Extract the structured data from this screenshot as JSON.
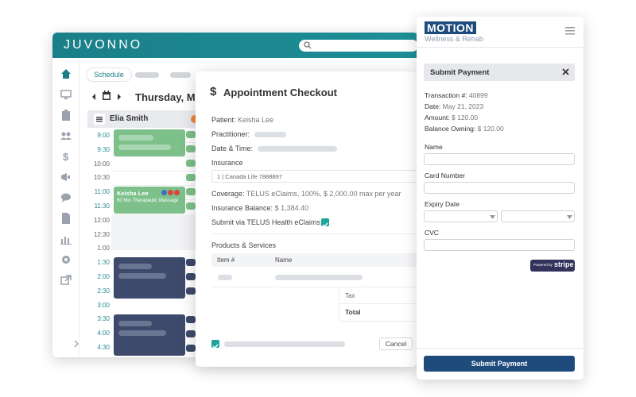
{
  "juvonno": {
    "logo": "JUVONNO",
    "tab_schedule": "Schedule",
    "date": "Thursday, May",
    "provider": "Elia Smith",
    "times": [
      "9:00",
      "9:30",
      "10:00",
      "10:30",
      "11:00",
      "11:30",
      "12:00",
      "12:30",
      "1:00",
      "1:30",
      "2:00",
      "2:30",
      "3:00",
      "3:30",
      "4:00",
      "4:30"
    ],
    "appointment": {
      "patient": "Keisha Lee",
      "service": "60 Min Therapeutic Massage"
    },
    "colors": {
      "teal": "#1a7f88",
      "green": "#7dc08a",
      "navy": "#3d4a6b"
    }
  },
  "checkout": {
    "title": "Appointment Checkout",
    "title_icon": "dollar-icon",
    "patient_label": "Patient:",
    "patient_value": "Keisha Lee",
    "practitioner_label": "Practitioner:",
    "datetime_label": "Date & Time:",
    "insurance_label": "Insurance",
    "insurance_value": "1 | Canada Life 7888897",
    "coverage_label": "Coverage:",
    "coverage_value": "TELUS eClaims, 100%, $ 2,000.00 max per year",
    "balance_label": "Insurance Balance:",
    "balance_value": "$ 1,384.40",
    "submit_label": "Submit via TELUS Health eClaims:",
    "products_label": "Products & Services",
    "col_item": "Item #",
    "col_name": "Name",
    "tax_label": "Tax",
    "total_label": "Total",
    "cancel_label": "Cancel"
  },
  "motion": {
    "brand": "MOTION",
    "tagline": "Wellness & Rehab",
    "panel_title": "Submit Payment",
    "transaction_label": "Transaction #:",
    "transaction_value": "40899",
    "date_label": "Date:",
    "date_value": "May 21, 2023",
    "amount_label": "Amount:",
    "amount_value": "$ 120.00",
    "owning_label": "Balance Owning:",
    "owning_value": "$ 120.00",
    "name_label": "Name",
    "card_label": "Card Number",
    "expiry_label": "Expiry Date",
    "cvc_label": "CVC",
    "stripe_powered": "Powered by",
    "stripe_brand": "stripe",
    "submit_button": "Submit Payment",
    "colors": {
      "navy": "#1e4a7c",
      "panel": "#e6e8eb"
    }
  }
}
